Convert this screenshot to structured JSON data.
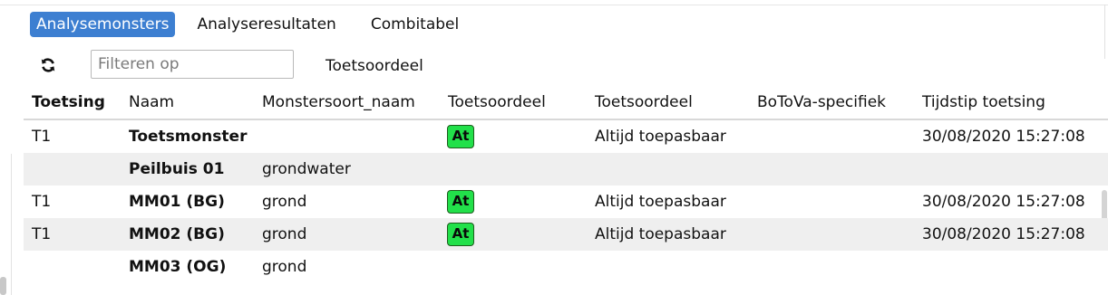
{
  "tabs": [
    {
      "label": "Analysemonsters",
      "active": true
    },
    {
      "label": "Analyseresultaten",
      "active": false
    },
    {
      "label": "Combitabel",
      "active": false
    }
  ],
  "toolbar": {
    "refresh_icon": "refresh-icon",
    "filter_placeholder": "Filteren op",
    "filter_value": "",
    "filter_label": "Toetsoordeel"
  },
  "colors": {
    "active_tab": "#3d7fd1",
    "badge_fill": "#22e04a",
    "badge_border": "#1d5b1d",
    "alt_row": "#efefef"
  },
  "table": {
    "columns": [
      "Toetsing",
      "Naam",
      "Monstersoort_naam",
      "Toetsoordeel",
      "Toetsoordeel",
      "BoToVa-specifiek",
      "Tijdstip toetsing"
    ],
    "rows": [
      {
        "toetsing": "T1",
        "naam": "Toetsmonster",
        "monstersoort": "",
        "badge": "At",
        "toetsoordeel": "Altijd toepasbaar",
        "botova": "",
        "tijdstip": "30/08/2020 15:27:08"
      },
      {
        "toetsing": "",
        "naam": "Peilbuis 01",
        "monstersoort": "grondwater",
        "badge": "",
        "toetsoordeel": "",
        "botova": "",
        "tijdstip": ""
      },
      {
        "toetsing": "T1",
        "naam": "MM01 (BG)",
        "monstersoort": "grond",
        "badge": "At",
        "toetsoordeel": "Altijd toepasbaar",
        "botova": "",
        "tijdstip": "30/08/2020 15:27:08"
      },
      {
        "toetsing": "T1",
        "naam": "MM02 (BG)",
        "monstersoort": "grond",
        "badge": "At",
        "toetsoordeel": "Altijd toepasbaar",
        "botova": "",
        "tijdstip": "30/08/2020 15:27:08"
      },
      {
        "toetsing": "",
        "naam": "MM03 (OG)",
        "monstersoort": "grond",
        "badge": "",
        "toetsoordeel": "",
        "botova": "",
        "tijdstip": ""
      }
    ]
  }
}
